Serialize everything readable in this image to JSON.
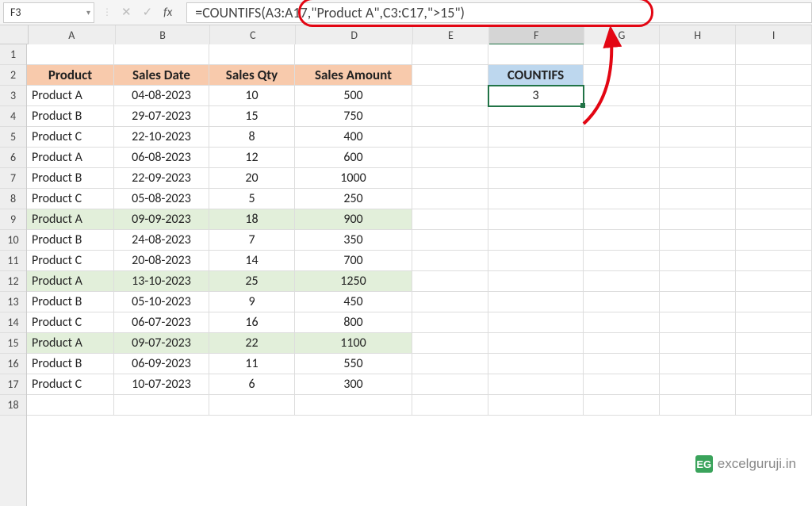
{
  "name_box": "F3",
  "formula": "=COUNTIFS(A3:A17,\"Product A\",C3:C17,\">15\")",
  "columns": [
    "A",
    "B",
    "C",
    "D",
    "E",
    "F",
    "G",
    "H",
    "I"
  ],
  "selected_column": "F",
  "rows_shown": 18,
  "headers": {
    "product": "Product",
    "sales_date": "Sales Date",
    "sales_qty": "Sales Qty",
    "sales_amount": "Sales Amount"
  },
  "countifs_header": "COUNTIFS",
  "countifs_result": "3",
  "data": [
    {
      "r": 3,
      "product": "Product A",
      "date": "04-08-2023",
      "qty": "10",
      "amount": "500",
      "hl": false
    },
    {
      "r": 4,
      "product": "Product B",
      "date": "29-07-2023",
      "qty": "15",
      "amount": "750",
      "hl": false
    },
    {
      "r": 5,
      "product": "Product C",
      "date": "22-10-2023",
      "qty": "8",
      "amount": "400",
      "hl": false
    },
    {
      "r": 6,
      "product": "Product A",
      "date": "06-08-2023",
      "qty": "12",
      "amount": "600",
      "hl": false
    },
    {
      "r": 7,
      "product": "Product B",
      "date": "22-09-2023",
      "qty": "20",
      "amount": "1000",
      "hl": false
    },
    {
      "r": 8,
      "product": "Product C",
      "date": "05-08-2023",
      "qty": "5",
      "amount": "250",
      "hl": false
    },
    {
      "r": 9,
      "product": "Product A",
      "date": "09-09-2023",
      "qty": "18",
      "amount": "900",
      "hl": true
    },
    {
      "r": 10,
      "product": "Product B",
      "date": "24-08-2023",
      "qty": "7",
      "amount": "350",
      "hl": false
    },
    {
      "r": 11,
      "product": "Product C",
      "date": "20-08-2023",
      "qty": "14",
      "amount": "700",
      "hl": false
    },
    {
      "r": 12,
      "product": "Product A",
      "date": "13-10-2023",
      "qty": "25",
      "amount": "1250",
      "hl": true
    },
    {
      "r": 13,
      "product": "Product B",
      "date": "05-10-2023",
      "qty": "9",
      "amount": "450",
      "hl": false
    },
    {
      "r": 14,
      "product": "Product C",
      "date": "06-07-2023",
      "qty": "16",
      "amount": "800",
      "hl": false
    },
    {
      "r": 15,
      "product": "Product A",
      "date": "09-07-2023",
      "qty": "22",
      "amount": "1100",
      "hl": true
    },
    {
      "r": 16,
      "product": "Product B",
      "date": "06-09-2023",
      "qty": "11",
      "amount": "550",
      "hl": false
    },
    {
      "r": 17,
      "product": "Product C",
      "date": "10-07-2023",
      "qty": "6",
      "amount": "300",
      "hl": false
    }
  ],
  "watermark": {
    "logo": "EG",
    "text": "excelguruji.in"
  }
}
